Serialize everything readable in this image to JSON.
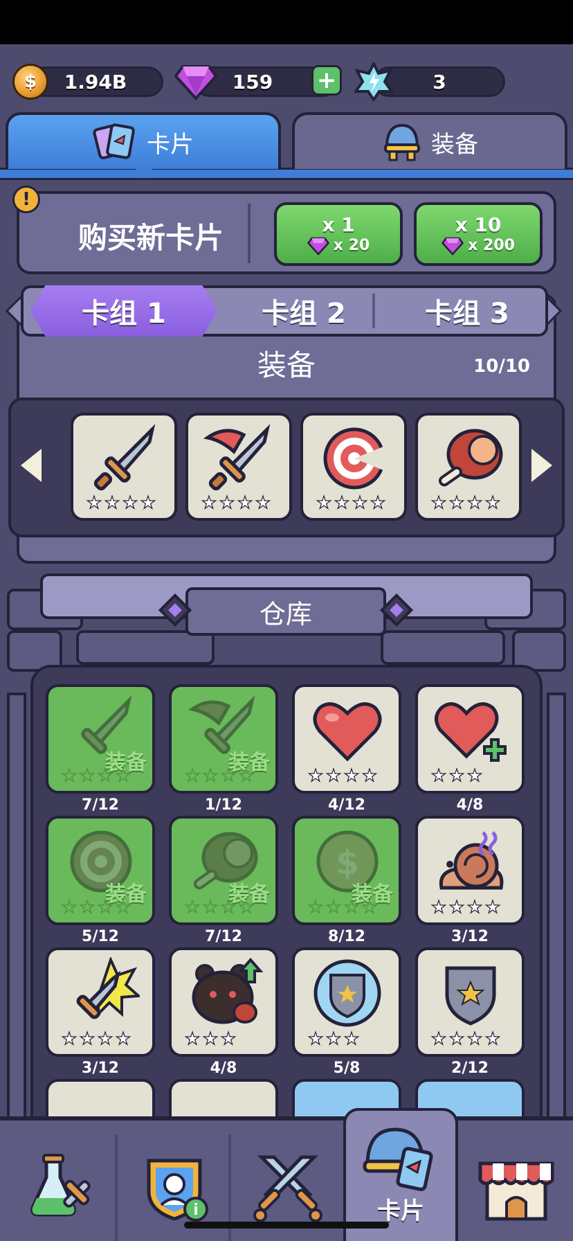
{
  "currency": {
    "coins": "1.94B",
    "gems": "159",
    "energy": "3"
  },
  "top_tabs": [
    {
      "label": "卡片",
      "active": true
    },
    {
      "label": "装备",
      "active": false
    }
  ],
  "buy": {
    "title": "购买新卡片",
    "options": [
      {
        "qty": "x 1",
        "cost": "x 20"
      },
      {
        "qty": "x 10",
        "cost": "x 200"
      }
    ]
  },
  "decks": {
    "tabs": [
      "卡组 1",
      "卡组 2",
      "卡组 3"
    ],
    "active_index": 0,
    "equip_label": "装备",
    "equip_count": "10/10",
    "cards": [
      {
        "icon": "sword-icon",
        "stars": 4
      },
      {
        "icon": "axe-sword-icon",
        "stars": 4
      },
      {
        "icon": "target-icon",
        "stars": 4
      },
      {
        "icon": "meat-icon",
        "stars": 4
      }
    ]
  },
  "warehouse": {
    "title": "仓库",
    "equip_tag": "装备",
    "items": [
      {
        "icon": "sword-icon",
        "stars": 4,
        "count": "7/12",
        "equipped": true
      },
      {
        "icon": "axe-sword-icon",
        "stars": 4,
        "count": "1/12",
        "equipped": true
      },
      {
        "icon": "heart-icon",
        "stars": 4,
        "count": "4/12",
        "equipped": false
      },
      {
        "icon": "heart-plus-icon",
        "stars": 3,
        "count": "4/8",
        "equipped": false
      },
      {
        "icon": "target-icon",
        "stars": 4,
        "count": "5/12",
        "equipped": true
      },
      {
        "icon": "meat-icon",
        "stars": 4,
        "count": "7/12",
        "equipped": true
      },
      {
        "icon": "coin-icon",
        "stars": 4,
        "count": "8/12",
        "equipped": true
      },
      {
        "icon": "poison-snail-icon",
        "stars": 4,
        "count": "3/12",
        "equipped": false
      },
      {
        "icon": "crit-sword-icon",
        "stars": 4,
        "count": "3/12",
        "equipped": false
      },
      {
        "icon": "bear-meat-up-icon",
        "stars": 3,
        "count": "4/8",
        "equipped": false
      },
      {
        "icon": "shield-bubble-icon",
        "stars": 3,
        "count": "5/8",
        "equipped": false
      },
      {
        "icon": "shield-icon",
        "stars": 4,
        "count": "2/12",
        "equipped": false
      }
    ]
  },
  "bottom_nav": [
    {
      "icon": "potion-tools-icon",
      "label": ""
    },
    {
      "icon": "character-badge-icon",
      "label": ""
    },
    {
      "icon": "crossed-swords-icon",
      "label": ""
    },
    {
      "icon": "helmet-card-icon",
      "label": "卡片",
      "active": true
    },
    {
      "icon": "shop-icon",
      "label": ""
    }
  ],
  "colors": {
    "background": "#4e4c6e",
    "panel": "#6f6c96",
    "outline": "#24223a",
    "tab_active": "#3e7ed9",
    "deck_active": "#8a5ee0",
    "buy_green": "#4fae4a",
    "equipped_green": "#6ab95a"
  }
}
